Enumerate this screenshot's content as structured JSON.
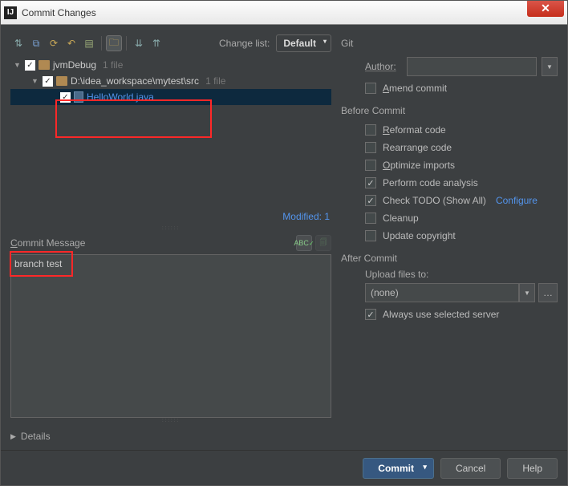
{
  "window": {
    "title": "Commit Changes"
  },
  "toolbar": {
    "change_list_label": "Change list:",
    "change_list_value": "Default"
  },
  "tree": {
    "root": {
      "label": "jvmDebug",
      "count": "1 file"
    },
    "folder": {
      "label": "D:\\idea_workspace\\mytest\\src",
      "count": "1 file"
    },
    "file": {
      "label": "HelloWorld.java"
    }
  },
  "modified": "Modified: 1",
  "commit_msg": {
    "label": "Commit Message",
    "value": "branch test"
  },
  "details": "Details",
  "git": {
    "title": "Git",
    "author_label": "Author:",
    "amend": "Amend commit"
  },
  "before": {
    "title": "Before Commit",
    "reformat": "Reformat code",
    "rearrange": "Rearrange code",
    "optimize": "Optimize imports",
    "analysis": "Perform code analysis",
    "todo": "Check TODO (Show All)",
    "configure": "Configure",
    "cleanup": "Cleanup",
    "copyright": "Update copyright"
  },
  "after": {
    "title": "After Commit",
    "upload_label": "Upload files to:",
    "upload_value": "(none)",
    "always": "Always use selected server"
  },
  "buttons": {
    "commit": "Commit",
    "cancel": "Cancel",
    "help": "Help"
  }
}
